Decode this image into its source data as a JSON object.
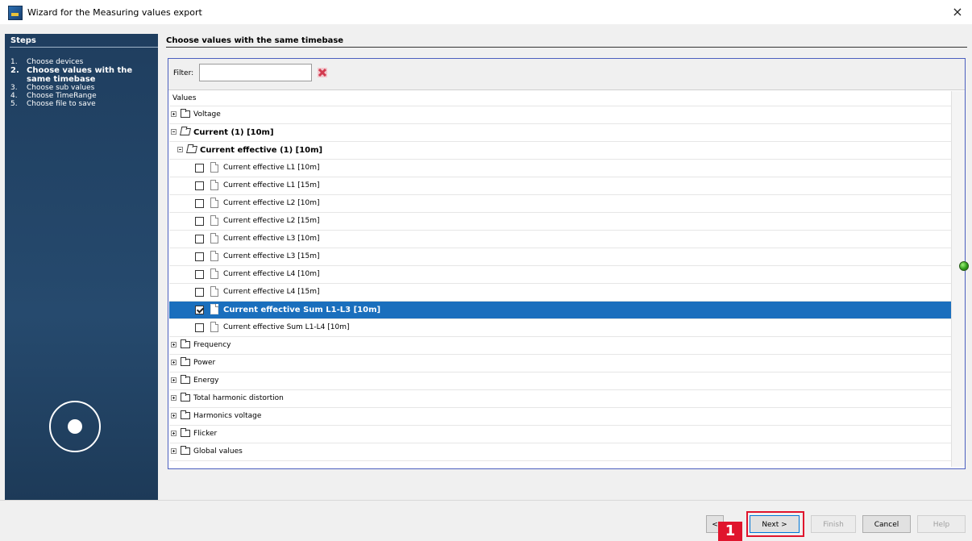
{
  "window": {
    "title": "Wizard for the Measuring values export",
    "close_glyph": "×"
  },
  "sidebar": {
    "steps_title": "Steps",
    "steps": [
      {
        "num": "1.",
        "label": "Choose devices",
        "active": false
      },
      {
        "num": "2.",
        "label": "Choose values with the same timebase",
        "active": true
      },
      {
        "num": "3.",
        "label": "Choose sub values",
        "active": false
      },
      {
        "num": "4.",
        "label": "Choose TimeRange",
        "active": false
      },
      {
        "num": "5.",
        "label": "Choose file to save",
        "active": false
      }
    ]
  },
  "main": {
    "heading": "Choose values with the same timebase",
    "filter": {
      "label": "Filter:",
      "value": ""
    },
    "tree_header": "Values",
    "tree": [
      {
        "label": "Voltage",
        "type": "group",
        "expanded": false
      },
      {
        "label": "Current (1) [10m]",
        "type": "group",
        "expanded": true,
        "bold": true
      },
      {
        "label": "Current effective (1) [10m]",
        "type": "subgroup",
        "expanded": true,
        "bold": true
      },
      {
        "label": "Current effective L1 [10m]",
        "type": "leaf",
        "checked": false
      },
      {
        "label": "Current effective L1 [15m]",
        "type": "leaf",
        "checked": false
      },
      {
        "label": "Current effective L2 [10m]",
        "type": "leaf",
        "checked": false
      },
      {
        "label": "Current effective L2 [15m]",
        "type": "leaf",
        "checked": false
      },
      {
        "label": "Current effective L3 [10m]",
        "type": "leaf",
        "checked": false
      },
      {
        "label": "Current effective L3 [15m]",
        "type": "leaf",
        "checked": false
      },
      {
        "label": "Current effective L4 [10m]",
        "type": "leaf",
        "checked": false
      },
      {
        "label": "Current effective L4 [15m]",
        "type": "leaf",
        "checked": false
      },
      {
        "label": "Current effective Sum L1-L3 [10m]",
        "type": "leaf",
        "checked": true,
        "selected": true
      },
      {
        "label": "Current effective Sum L1-L4 [10m]",
        "type": "leaf",
        "checked": false
      },
      {
        "label": "Frequency",
        "type": "group",
        "expanded": false
      },
      {
        "label": "Power",
        "type": "group",
        "expanded": false
      },
      {
        "label": "Energy",
        "type": "group",
        "expanded": false
      },
      {
        "label": "Total harmonic distortion",
        "type": "group",
        "expanded": false
      },
      {
        "label": "Harmonics voltage",
        "type": "group",
        "expanded": false
      },
      {
        "label": "Flicker",
        "type": "group",
        "expanded": false
      },
      {
        "label": "Global values",
        "type": "group",
        "expanded": false
      }
    ]
  },
  "footer": {
    "back_label": "<",
    "next_label": "Next >",
    "finish_label": "Finish",
    "cancel_label": "Cancel",
    "help_label": "Help",
    "callout_number": "1"
  },
  "colors": {
    "selection": "#1a6fbd",
    "highlight": "#e0152d",
    "sidebar": "#264a6e"
  },
  "icons": [
    "app-icon",
    "close-icon",
    "clear-filter-icon",
    "folder-icon",
    "document-icon",
    "status-ok-icon",
    "wizard-badge-icon"
  ]
}
